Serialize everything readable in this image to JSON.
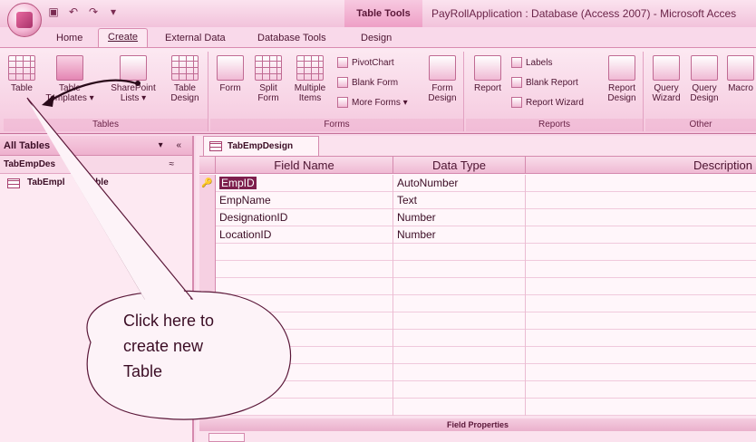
{
  "title_bar": {
    "context_tab_title": "Table Tools",
    "window_title": "PayRollApplication : Database (Access 2007) - Microsoft Acces",
    "qat_icons": [
      "save-icon",
      "undo-icon",
      "redo-icon",
      "customize-icon"
    ]
  },
  "tabs": {
    "home": "Home",
    "create": "Create",
    "external": "External Data",
    "dbtools": "Database Tools",
    "design": "Design"
  },
  "ribbon": {
    "tables": {
      "label": "Tables",
      "table": "Table",
      "table_templates": [
        "Table",
        "Templates ▾"
      ],
      "sharepoint": [
        "SharePoint",
        "Lists ▾"
      ],
      "table_design": [
        "Table",
        "Design"
      ]
    },
    "forms": {
      "label": "Forms",
      "form": "Form",
      "split_form": [
        "Split",
        "Form"
      ],
      "multiple_items": [
        "Multiple",
        "Items"
      ],
      "pivotchart": "PivotChart",
      "blank_form": "Blank Form",
      "more_forms": "More Forms ▾",
      "form_design": [
        "Form",
        "Design"
      ]
    },
    "reports": {
      "label": "Reports",
      "report": "Report",
      "labels": "Labels",
      "blank_report": "Blank Report",
      "report_wizard": "Report Wizard",
      "report_design": [
        "Report",
        "Design"
      ]
    },
    "other": {
      "label": "Other",
      "query_wizard": [
        "Query",
        "Wizard"
      ],
      "query_design": [
        "Query",
        "Design"
      ],
      "macro": "Macro"
    }
  },
  "nav_pane": {
    "header": "All Tables",
    "header_controls": "▾ «",
    "group": "TabEmpDes",
    "group_chevron": "≈",
    "item": "TabEmpl      : Table"
  },
  "document": {
    "tab_label": "TabEmpDesign",
    "columns": [
      "Field Name",
      "Data Type",
      "Description"
    ],
    "rows": [
      {
        "field": "EmpID",
        "type": "AutoNumber",
        "key": "🔑"
      },
      {
        "field": "EmpName",
        "type": "Text",
        "key": ""
      },
      {
        "field": "DesignationID",
        "type": "Number",
        "key": ""
      },
      {
        "field": "LocationID",
        "type": "Number",
        "key": ""
      }
    ],
    "field_properties": "Field Properties"
  },
  "callout": {
    "lines": [
      "Click here to",
      "create new",
      "Table"
    ]
  },
  "colors": {
    "ribbon_bg": "#f5c8de",
    "selection": "#7d1f4d",
    "border": "#d58aae"
  }
}
